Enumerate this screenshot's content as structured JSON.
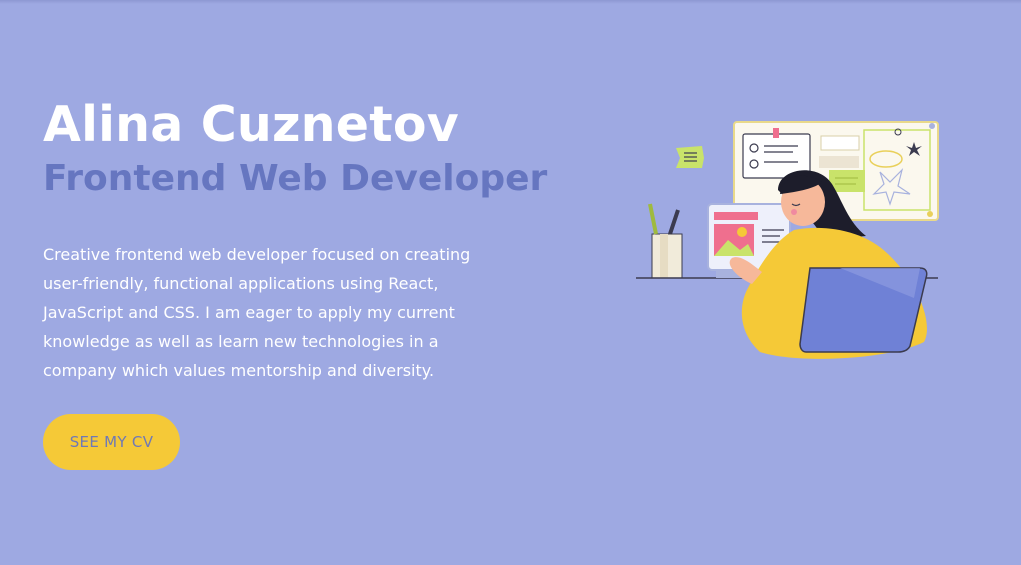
{
  "hero": {
    "name": "Alina Cuznetov",
    "role": "Frontend Web Developer",
    "bio": "Creative frontend web developer focused on creating user-friendly, functional applications using React, JavaScript and CSS. I am eager to apply my current knowledge as well as learn new technologies in a company which values mentorship and diversity.",
    "cv_button_label": "SEE MY CV"
  },
  "colors": {
    "background": "#9ea9e2",
    "name": "#ffffff",
    "role": "#6676c0",
    "button": "#f5c937",
    "button_text": "#6f79b6"
  },
  "illustration": {
    "icon": "developer-at-laptop-illustration"
  }
}
